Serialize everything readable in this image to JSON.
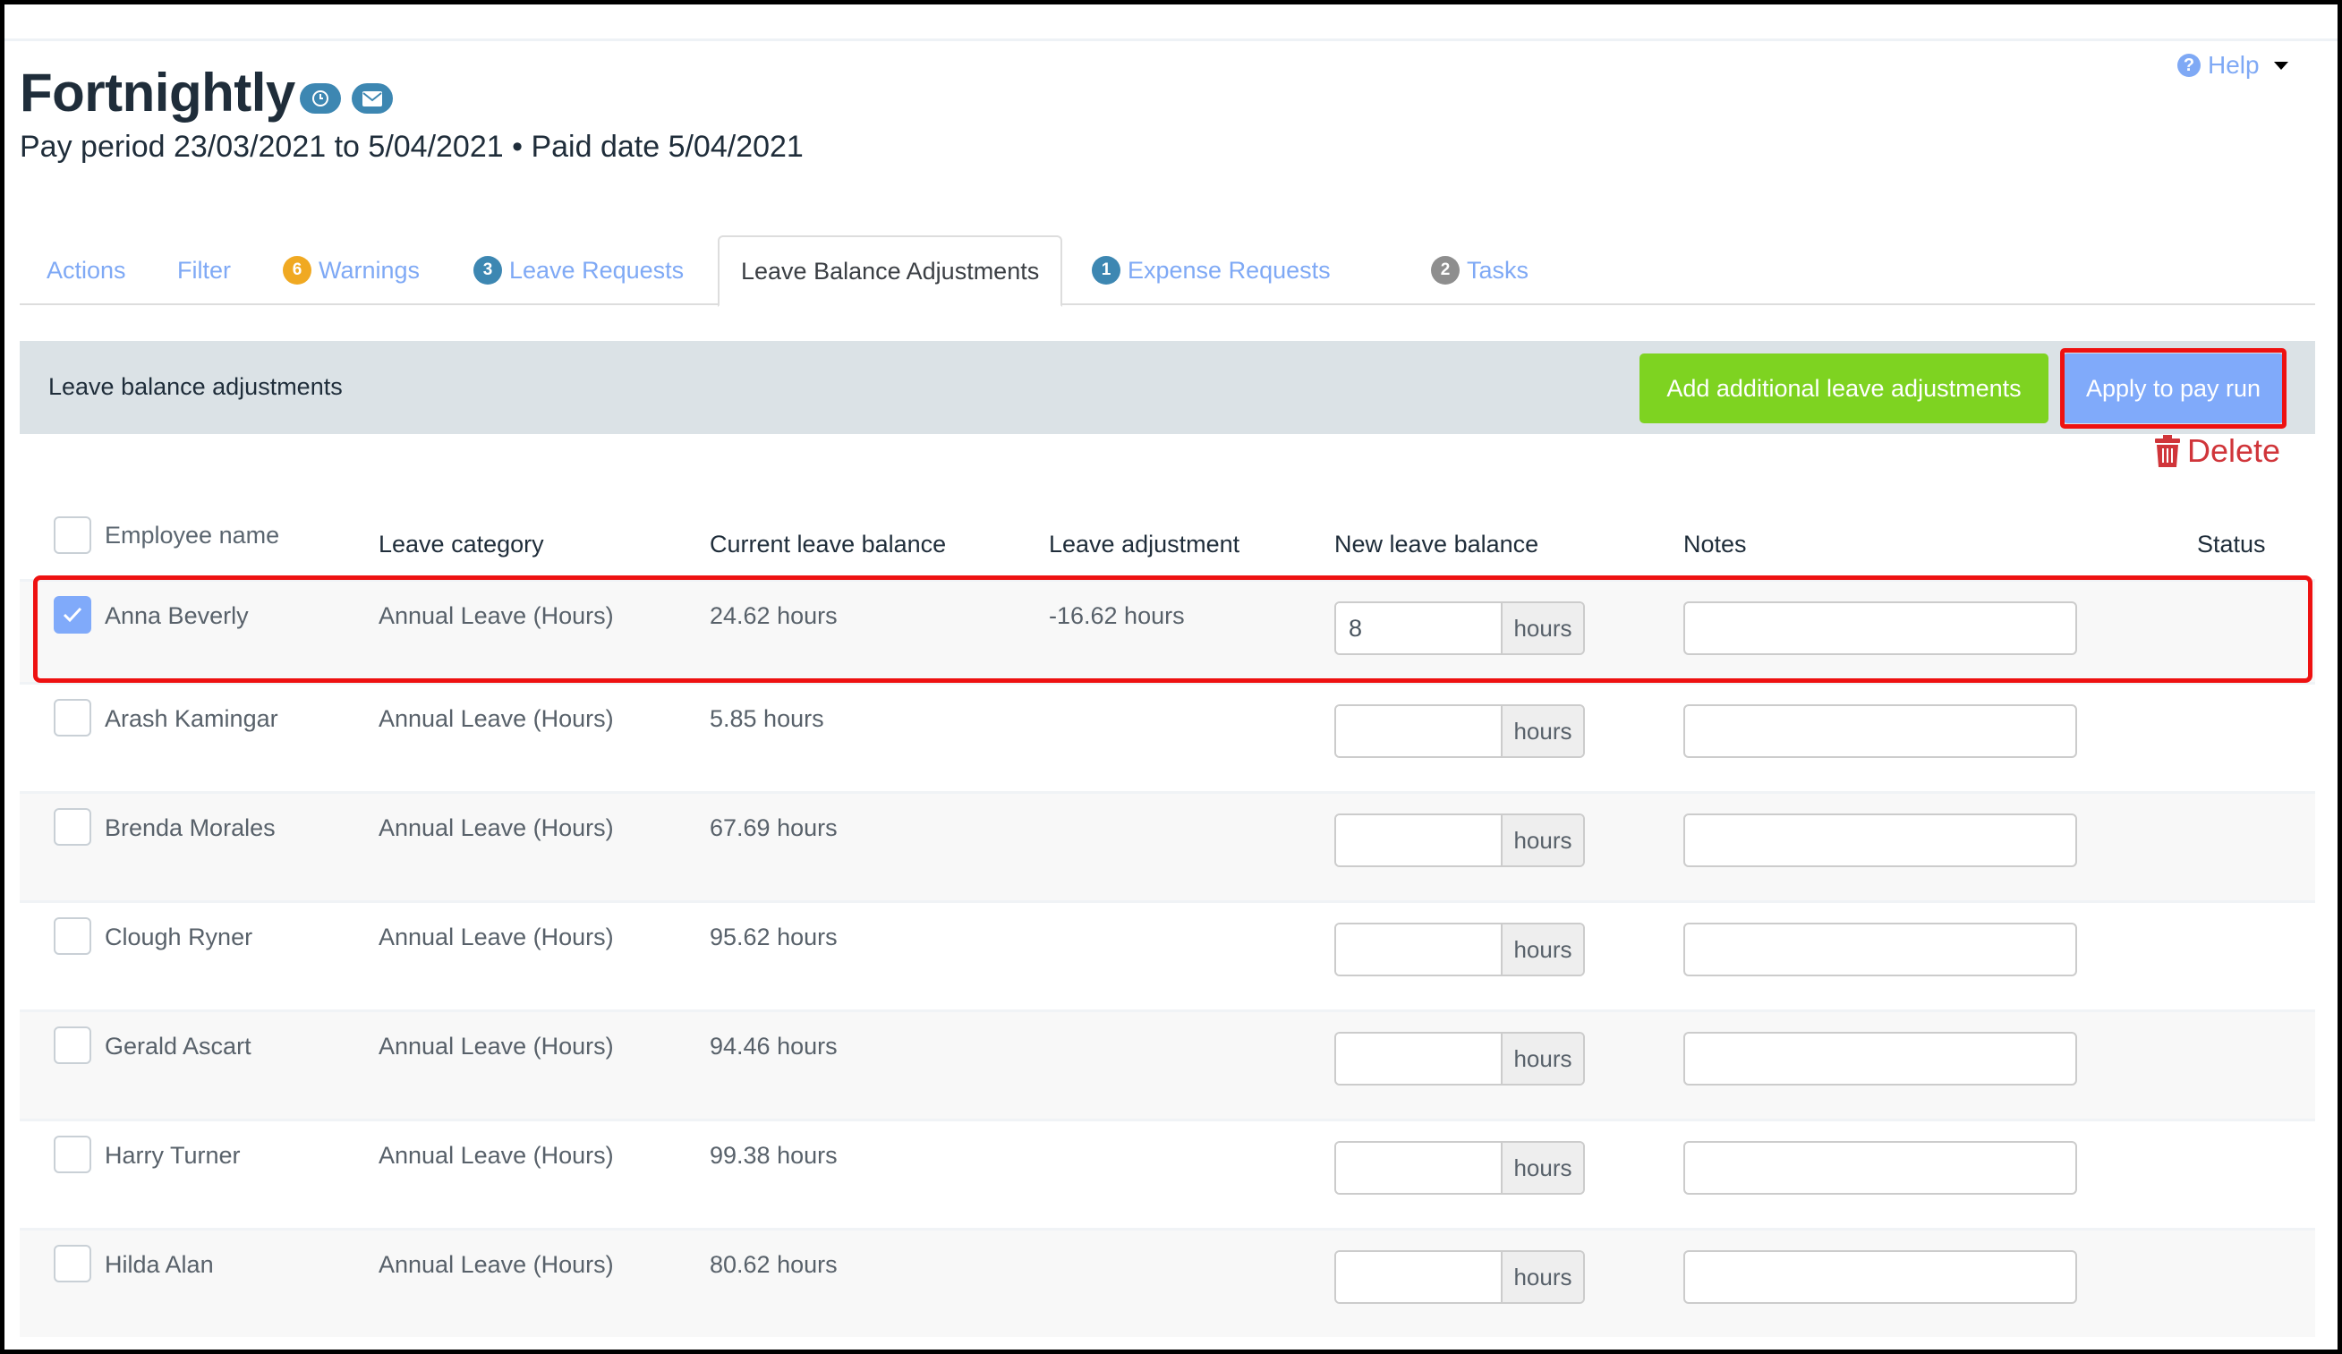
{
  "header": {
    "title": "Fortnightly",
    "subtitle": "Pay period 23/03/2021 to 5/04/2021 • Paid date 5/04/2021",
    "icons": [
      "clock-icon",
      "envelope-icon"
    ],
    "help_label": "Help"
  },
  "tabs": [
    {
      "label": "Actions",
      "badge": null
    },
    {
      "label": "Filter",
      "badge": null
    },
    {
      "label": "Warnings",
      "badge": "6",
      "badge_color": "#f0a922"
    },
    {
      "label": "Leave Requests",
      "badge": "3",
      "badge_color": "#3d87b2"
    },
    {
      "label": "Leave Balance Adjustments",
      "badge": null,
      "active": true
    },
    {
      "label": "Expense Requests",
      "badge": "1",
      "badge_color": "#3d87b2"
    },
    {
      "label": "Tasks",
      "badge": "2",
      "badge_color": "#8e8e8e"
    }
  ],
  "panel": {
    "title": "Leave balance adjustments",
    "add_button": "Add additional leave adjustments",
    "apply_button": "Apply to pay run",
    "delete_label": "Delete"
  },
  "table": {
    "columns": [
      "Employee name",
      "Leave category",
      "Current leave balance",
      "Leave adjustment",
      "New leave balance",
      "Notes",
      "Status"
    ],
    "unit_label": "hours",
    "rows": [
      {
        "name": "Anna Beverly",
        "category": "Annual Leave (Hours)",
        "current": "24.62 hours",
        "adjustment": "-16.62 hours",
        "new_balance": "8",
        "notes": "",
        "status": "",
        "checked": true
      },
      {
        "name": "Arash Kamingar",
        "category": "Annual Leave (Hours)",
        "current": "5.85 hours",
        "adjustment": "",
        "new_balance": "",
        "notes": "",
        "status": "",
        "checked": false
      },
      {
        "name": "Brenda Morales",
        "category": "Annual Leave (Hours)",
        "current": "67.69 hours",
        "adjustment": "",
        "new_balance": "",
        "notes": "",
        "status": "",
        "checked": false
      },
      {
        "name": "Clough Ryner",
        "category": "Annual Leave (Hours)",
        "current": "95.62 hours",
        "adjustment": "",
        "new_balance": "",
        "notes": "",
        "status": "",
        "checked": false
      },
      {
        "name": "Gerald Ascart",
        "category": "Annual Leave (Hours)",
        "current": "94.46 hours",
        "adjustment": "",
        "new_balance": "",
        "notes": "",
        "status": "",
        "checked": false
      },
      {
        "name": "Harry Turner",
        "category": "Annual Leave (Hours)",
        "current": "99.38 hours",
        "adjustment": "",
        "new_balance": "",
        "notes": "",
        "status": "",
        "checked": false
      },
      {
        "name": "Hilda Alan",
        "category": "Annual Leave (Hours)",
        "current": "80.62 hours",
        "adjustment": "",
        "new_balance": "",
        "notes": "",
        "status": "",
        "checked": false
      }
    ]
  },
  "colors": {
    "accent_blue": "#80aafa",
    "green": "#7ed321",
    "danger": "#d0353a",
    "highlight": "#ee1111",
    "panel_header": "#dbe2e6"
  }
}
